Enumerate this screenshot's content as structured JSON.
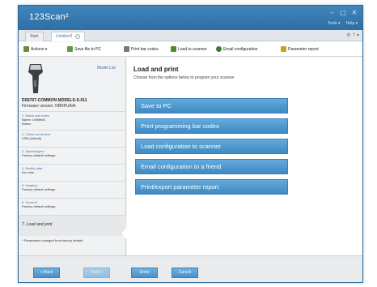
{
  "window": {
    "title": "123Scan²",
    "menu": [
      "Tools ▾",
      "Help ▾"
    ]
  },
  "tabs": [
    {
      "label": "Start",
      "active": false
    },
    {
      "label": "Unititled1",
      "active": true
    }
  ],
  "toolbar": {
    "actions_label": "Actions ▾",
    "save_label": "Save file to PC",
    "print_label": "Print bar codes",
    "load_label": "Load to scanner",
    "email_label": "Email configuration",
    "report_label": "Parameter report"
  },
  "sidebar": {
    "model_list_link": "Model List",
    "model_name": "DS6707-COMMON MODELS-S-011",
    "firmware": "Firmware version: NBRPUAAI",
    "steps": [
      {
        "title": "1. Name and notes",
        "lines": [
          "Name: Unititled1",
          "Notes:"
        ]
      },
      {
        "title": "2. Cable connection",
        "lines": [
          "USB (default)"
        ]
      },
      {
        "title": "3. Symbologies",
        "lines": [
          "Factory default settings"
        ]
      },
      {
        "title": "4. Modify data",
        "lines": [
          "No rules"
        ]
      },
      {
        "title": "5. Imaging",
        "lines": [
          "Factory default settings"
        ]
      },
      {
        "title": "6. General",
        "lines": [
          "Factory default settings"
        ]
      },
      {
        "title": "7. Load and print",
        "lines": []
      }
    ],
    "footnote": "* Parameters changed from factory default"
  },
  "main": {
    "title": "Load and print",
    "subtitle": "Choose from the options below to program your scanner",
    "buttons": [
      "Save to PC",
      "Print programming bar codes",
      "Load configuration to scanner",
      "Email configuration to a friend",
      "Print/export parameter report"
    ]
  },
  "footer": {
    "back": "« Back",
    "next": "Next »",
    "done": "Done",
    "cancel": "Cancel"
  },
  "colors": {
    "accent": "#4a91c9",
    "titlebar": "#3f86bd",
    "link": "#3a77b3"
  }
}
